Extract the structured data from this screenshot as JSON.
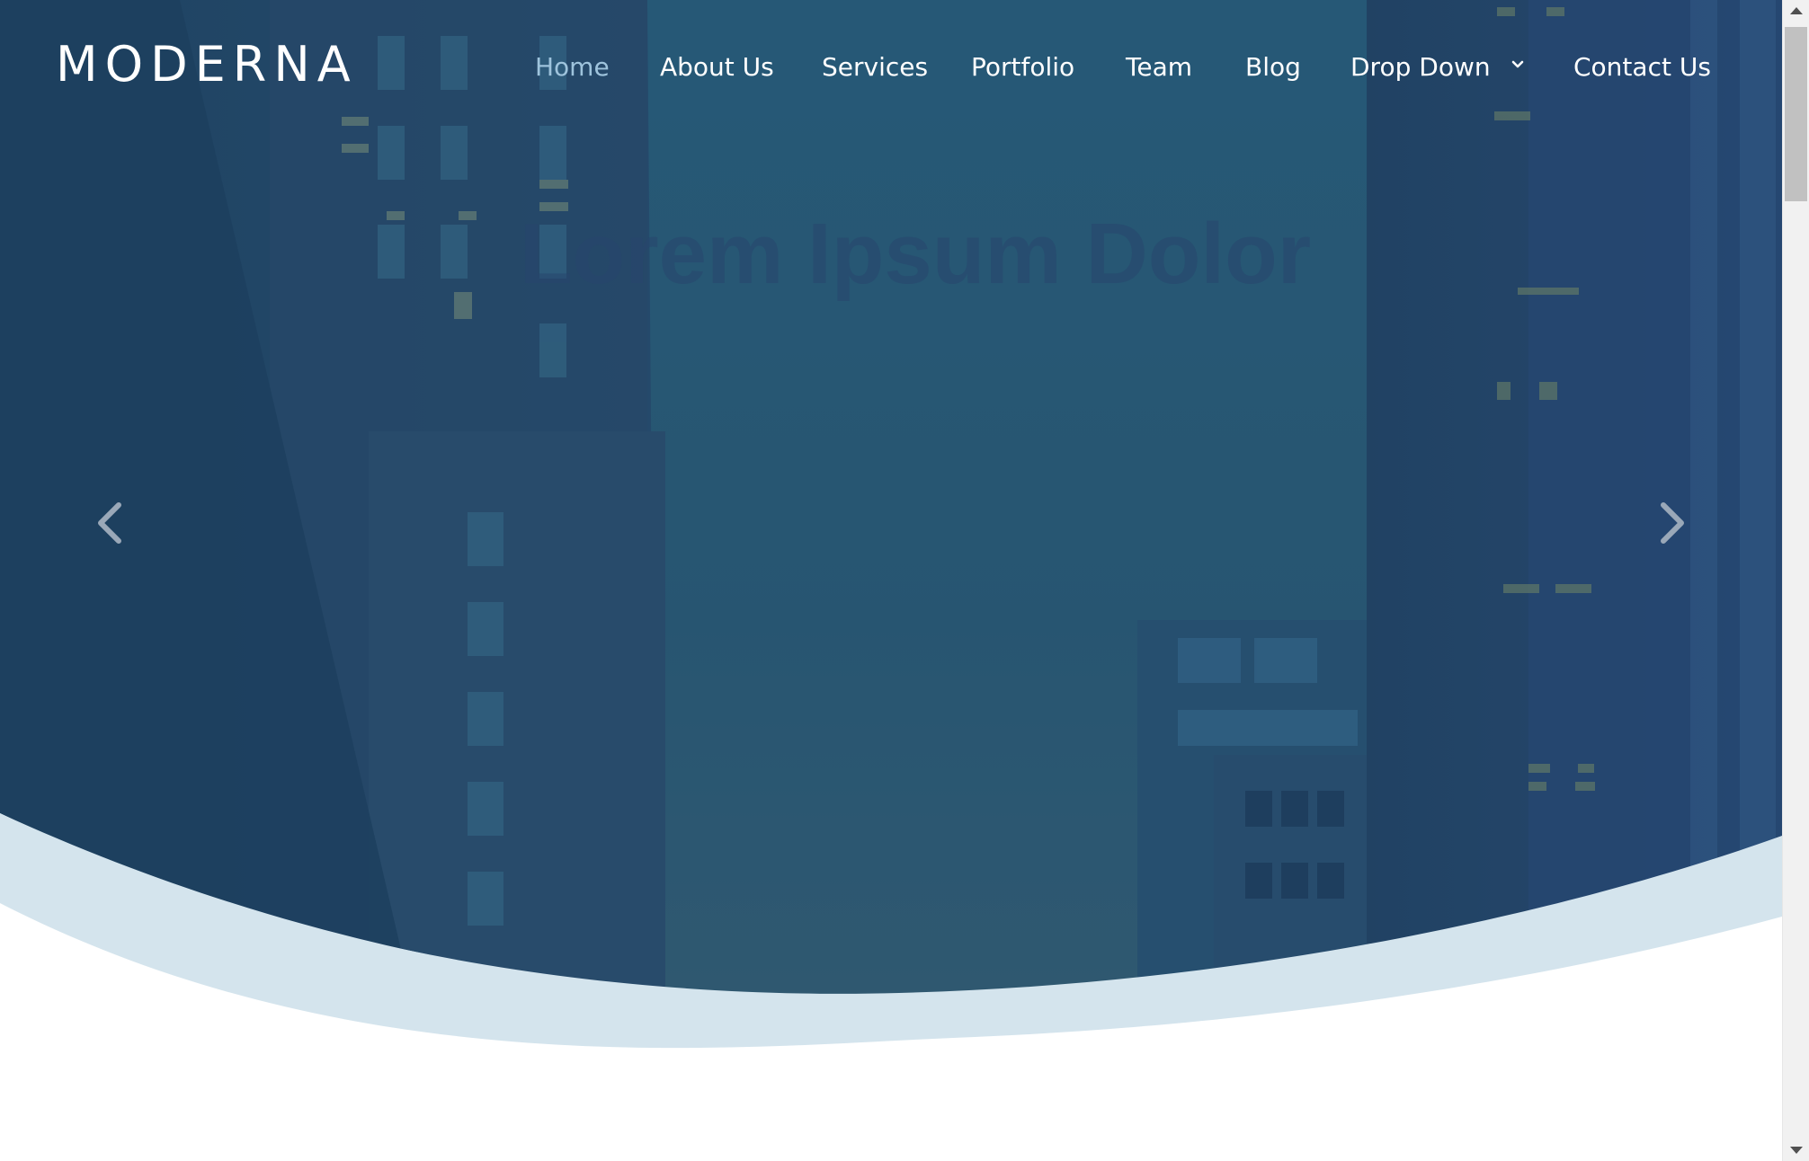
{
  "brand": {
    "logo_text": "MODERNA"
  },
  "nav": {
    "items": [
      {
        "label": "Home",
        "active": true
      },
      {
        "label": "About Us"
      },
      {
        "label": "Services"
      },
      {
        "label": "Portfolio"
      },
      {
        "label": "Team"
      },
      {
        "label": "Blog"
      },
      {
        "label": "Drop Down",
        "has_dropdown": true,
        "icon": "chevron-down-icon"
      },
      {
        "label": "Contact Us"
      }
    ]
  },
  "hero": {
    "title": "Lorem Ipsum Dolor",
    "prev_icon": "chevron-left-icon",
    "next_icon": "chevron-right-icon"
  },
  "colors": {
    "overlay": "#1f4d6e",
    "wave": "#d4e4ed",
    "nav_active": "#9ec3dc",
    "text": "#ffffff"
  }
}
